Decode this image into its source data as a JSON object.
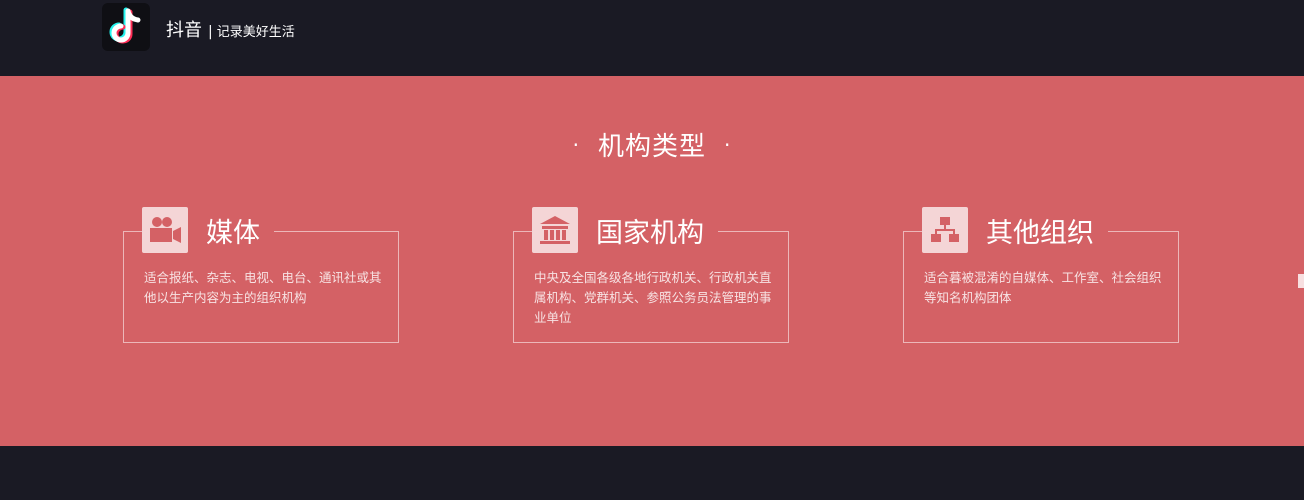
{
  "header": {
    "app_name": "抖音",
    "separator": "|",
    "slogan": "记录美好生活",
    "logo_icon": "tiktok-note-icon"
  },
  "section": {
    "title": "机构类型",
    "dot_left": "·",
    "dot_right": "·"
  },
  "cards": [
    {
      "title": "媒体",
      "icon": "video-camera-icon",
      "description": "适合报纸、杂志、电视、电台、通讯社或其他以生产内容为主的组织机构"
    },
    {
      "title": "国家机构",
      "icon": "government-building-icon",
      "description": "中央及全国各级各地行政机关、行政机关直属机构、党群机关、参照公务员法管理的事业单位"
    },
    {
      "title": "其他组织",
      "icon": "org-chart-icon",
      "description": "适合暮被混淆的自媒体、工作室、社会组织等知名机构团体"
    }
  ],
  "colors": {
    "band_background": "#d46165",
    "page_background": "#1a1a24",
    "icon_tile": "#f4d5d6"
  }
}
